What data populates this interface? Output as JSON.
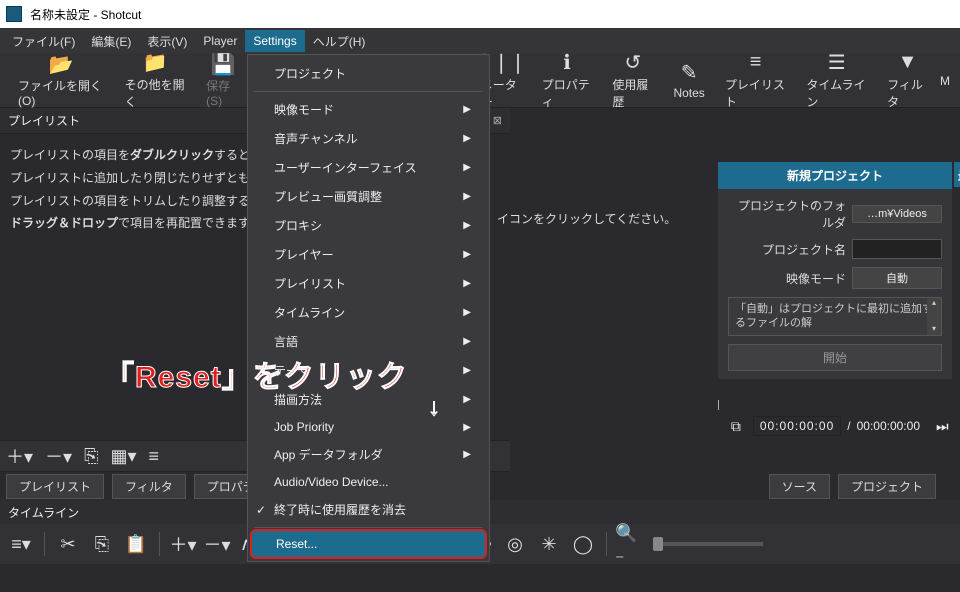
{
  "window": {
    "title": "名称未設定 - Shotcut"
  },
  "menubar": {
    "file": "ファイル(F)",
    "edit": "編集(E)",
    "view": "表示(V)",
    "player": "Player",
    "settings": "Settings",
    "help": "ヘルプ(H)"
  },
  "toolbar": {
    "open": "ファイルを開く(O)",
    "open_other": "その他を開く",
    "save": "保存(S)",
    "meter": "メーター",
    "property": "プロパティ",
    "history": "使用履歴",
    "notes": "Notes",
    "playlist": "プレイリスト",
    "timeline": "タイムライン",
    "filter": "フィルタ",
    "more": "M"
  },
  "playlist": {
    "title": "プレイリスト",
    "line1a": "プレイリストの項目を",
    "line1b": "ダブルクリック",
    "line1c": "すると、プレイ",
    "line2": "プレイリストに追加したり閉じたりせずとも自由に",
    "line3": "プレイリストの項目をトリムしたり調整するには、",
    "line4a": "ドラッグ＆ドロップ",
    "line4b": "で項目を再配置できます。",
    "hint_tail": "イコンをクリックしてください。"
  },
  "settings_menu": {
    "project": "プロジェクト",
    "video_mode": "映像モード",
    "audio_channel": "音声チャンネル",
    "ui": "ユーザーインターフェイス",
    "preview_quality": "プレビュー画質調整",
    "proxy": "プロキシ",
    "player": "プレイヤー",
    "playlist": "プレイリスト",
    "timeline": "タイムライン",
    "language": "言語",
    "theme": "テーマ",
    "draw_method": "描画方法",
    "job_priority": "Job Priority",
    "app_data": "App データフォルダ",
    "av_device": "Audio/Video Device...",
    "clear_on_exit": "終了時に使用履歴を消去",
    "reset": "Reset..."
  },
  "new_project": {
    "title": "新規プロジェクト",
    "folder_label": "プロジェクトのフォルダ",
    "folder_value": "…m¥Videos",
    "name_label": "プロジェクト名",
    "mode_label": "映像モード",
    "mode_value": "自動",
    "note": "「自動」はプロジェクトに最初に追加するファイルの解",
    "start_btn": "開始",
    "right_tab": "最"
  },
  "time": {
    "current": "00:00:00:00",
    "total": "00:00:00:00",
    "sep": "/"
  },
  "tabs": {
    "playlist": "プレイリスト",
    "filter": "フィルタ",
    "property": "プロパティ",
    "source": "ソース",
    "project": "プロジェクト"
  },
  "timeline": {
    "title": "タイムライン"
  },
  "annotation": {
    "text": "「Reset」をクリック",
    "arrow": "↓"
  }
}
